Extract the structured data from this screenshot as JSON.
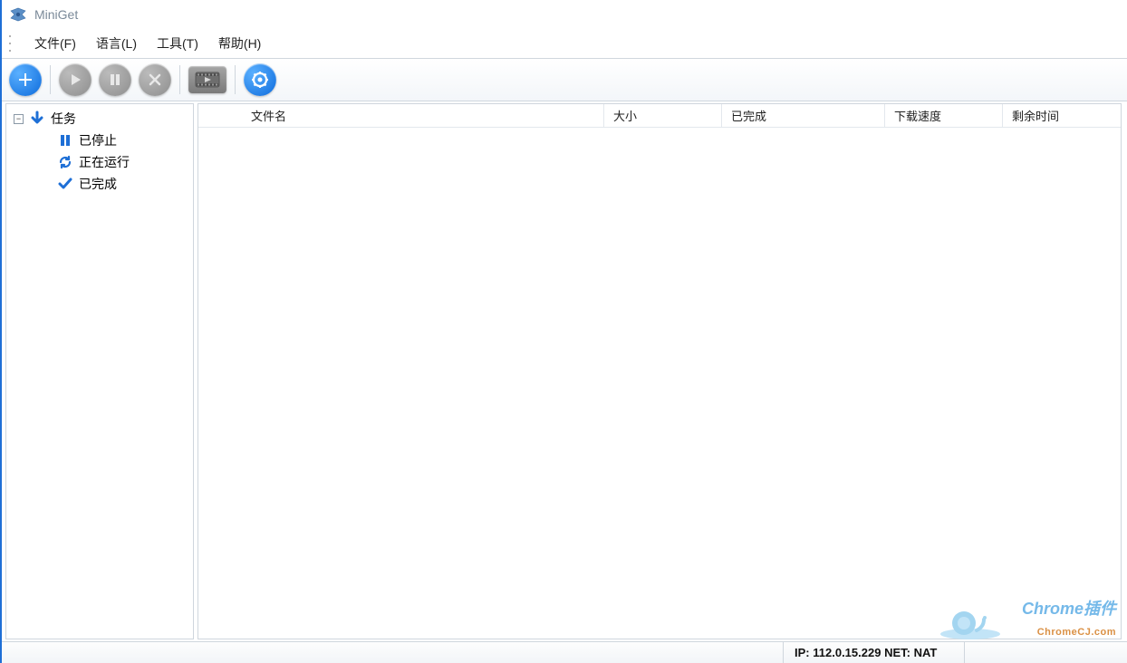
{
  "app": {
    "title": "MiniGet"
  },
  "menu": {
    "file": "文件(F)",
    "language": "语言(L)",
    "tools": "工具(T)",
    "help": "帮助(H)"
  },
  "toolbar": {
    "add": "add-task",
    "start": "start",
    "pause": "pause",
    "stop": "stop",
    "video": "video",
    "settings": "settings"
  },
  "sidebar": {
    "root": "任务",
    "items": [
      {
        "label": "已停止",
        "icon": "pause"
      },
      {
        "label": "正在运行",
        "icon": "refresh"
      },
      {
        "label": "已完成",
        "icon": "check"
      }
    ]
  },
  "columns": {
    "filename": "文件名",
    "size": "大小",
    "completed": "已完成",
    "speed": "下载速度",
    "remaining": "剩余时间"
  },
  "status": {
    "ip_label": "IP:",
    "ip_value": "112.0.15.229",
    "net_label": "NET:",
    "net_value": "NAT"
  },
  "watermark": {
    "line1": "Chrome插件",
    "line2": "ChromeCJ.com"
  }
}
